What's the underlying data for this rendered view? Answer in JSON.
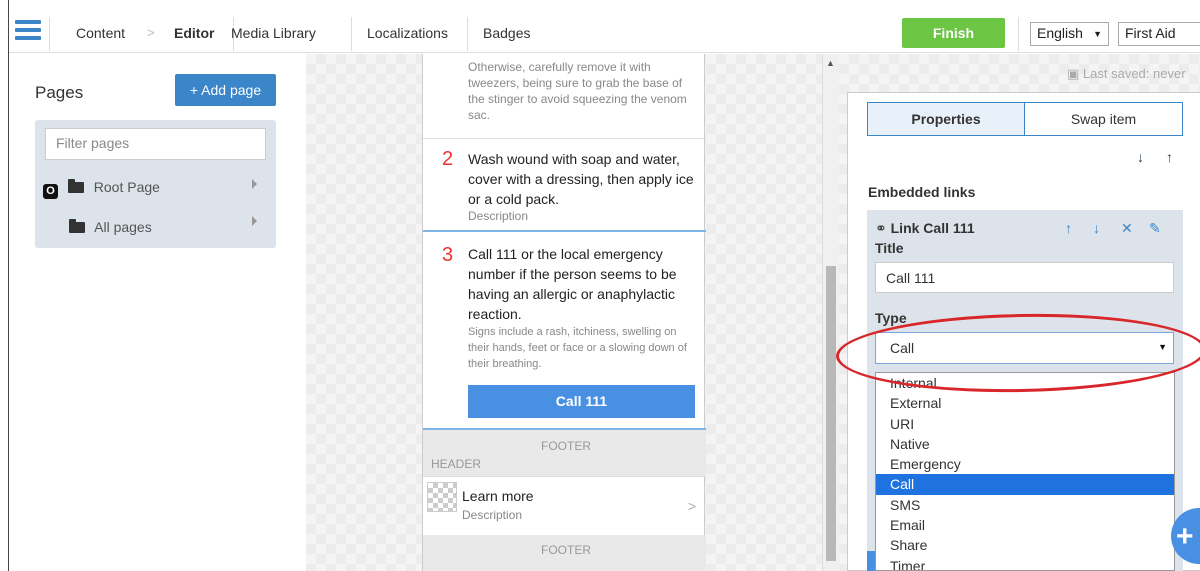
{
  "nav": {
    "tabs": [
      "Content",
      "Editor",
      "Media Library",
      "Localizations",
      "Badges"
    ],
    "finish_label": "Finish",
    "language": "English",
    "app_name": "First Aid"
  },
  "pages": {
    "title": "Pages",
    "add_label": "Add page",
    "filter_placeholder": "Filter pages",
    "root_badge": "O",
    "root_label": "Root Page",
    "all_label": "All pages"
  },
  "preview": {
    "step1_text": "Otherwise, carefully remove it with tweezers, being sure to grab the base of the stinger to avoid squeezing the venom sac.",
    "step2_num": "2",
    "step2_text": "Wash wound with soap and water, cover with a dressing, then apply ice or a cold pack.",
    "step2_desc": "Description",
    "step3_num": "3",
    "step3_text": "Call 111 or the local emergency number if the person seems to be having an allergic or anaphylactic reaction.",
    "step3_desc": "Signs include a rash, itchiness, swelling on their hands, feet or face or a slowing down of their breathing.",
    "call_button": "Call 111",
    "footer_label": "FOOTER",
    "header_label": "HEADER",
    "learn_more": "Learn more",
    "learn_desc": "Description",
    "footer_label2": "FOOTER"
  },
  "properties": {
    "last_saved": "Last saved: never",
    "tab_properties": "Properties",
    "tab_swap": "Swap item",
    "embedded_links": "Embedded links",
    "link_title": "Link Call 111",
    "title_label": "Title",
    "title_value": "Call 111",
    "type_label": "Type",
    "type_value": "Call",
    "type_options": [
      "Internal",
      "External",
      "URI",
      "Native",
      "Emergency",
      "Call",
      "SMS",
      "Email",
      "Share",
      "Timer"
    ],
    "selected_option": "Call"
  },
  "colors": {
    "accent": "#3a86c8",
    "finish": "#6cc644",
    "step_number": "#e33333",
    "annotation_ring": "#d9262a",
    "selected_option": "#1e73e0"
  }
}
